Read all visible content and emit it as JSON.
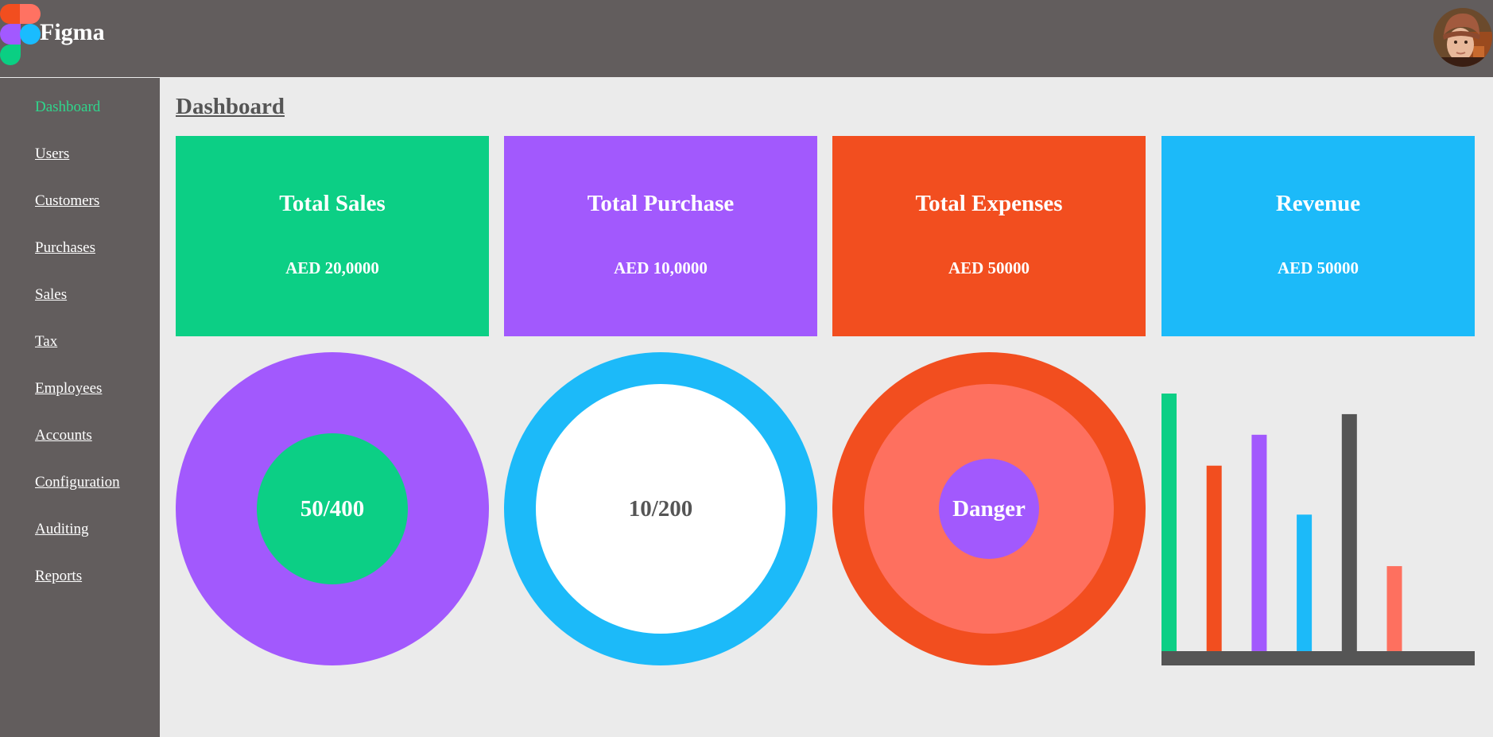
{
  "app": {
    "name": "Figma"
  },
  "header": {
    "avatar_icon": "user-avatar-icon"
  },
  "sidebar": {
    "items": [
      {
        "label": "Dashboard",
        "active": true
      },
      {
        "label": "Users"
      },
      {
        "label": "Customers"
      },
      {
        "label": "Purchases"
      },
      {
        "label": "Sales"
      },
      {
        "label": "Tax"
      },
      {
        "label": "Employees"
      },
      {
        "label": "Accounts"
      },
      {
        "label": "Configuration"
      },
      {
        "label": "Auditing"
      },
      {
        "label": "Reports"
      }
    ]
  },
  "main": {
    "title": "Dashboard",
    "cards": [
      {
        "title": "Total Sales",
        "value": "AED 20,0000",
        "color": "#0ccf85"
      },
      {
        "title": "Total Purchase",
        "value": "AED 10,0000",
        "color": "#a259fd"
      },
      {
        "title": "Total Expenses",
        "value": "AED 50000",
        "color": "#f24e1f"
      },
      {
        "title": "Revenue",
        "value": "AED 50000",
        "color": "#1cbaf9"
      }
    ],
    "gauges": [
      {
        "label": "50/400",
        "outer_color": "#a259fd",
        "inner_color": "#0ccf85",
        "text_color": "#ffffff"
      },
      {
        "label": "10/200",
        "outer_color": "#1cbaf9",
        "inner_color": "#ffffff",
        "text_color": "#555555"
      },
      {
        "label": "Danger",
        "outer_color": "#f24e1f",
        "middle_color": "#fe705f",
        "inner_color": "#a259fd",
        "text_color": "#ffffff"
      }
    ]
  },
  "chart_data": {
    "type": "bar",
    "title": "",
    "xlabel": "",
    "ylabel": "",
    "ylim": [
      0,
      100
    ],
    "grid": false,
    "legend": "none",
    "categories": [
      "",
      "",
      "",
      "",
      "",
      ""
    ],
    "values": [
      100,
      72,
      84,
      53,
      92,
      33
    ],
    "colors": [
      "#0ccf85",
      "#f24e1f",
      "#a259fd",
      "#1cbaf9",
      "#555555",
      "#fe705f"
    ],
    "baseline_color": "#555555"
  }
}
